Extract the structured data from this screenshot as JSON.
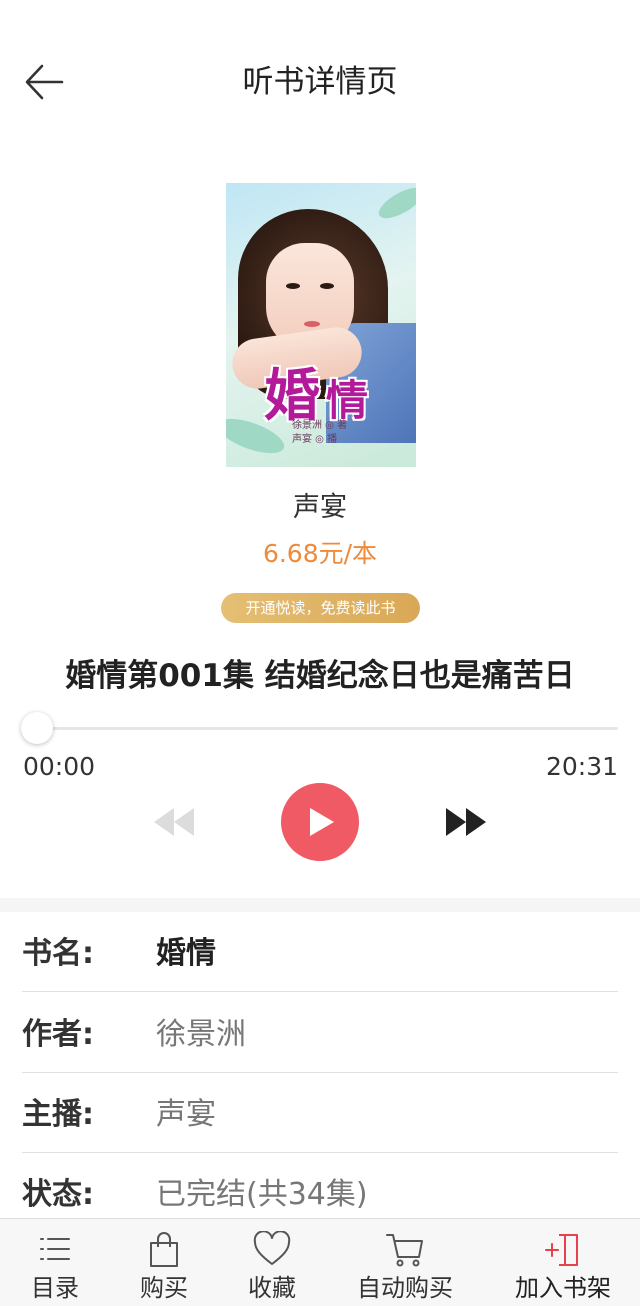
{
  "header": {
    "title": "听书详情页",
    "back_icon": "arrow-left-icon"
  },
  "book": {
    "cover_title": "婚情",
    "cover_author_line": "徐景洲 ◎ 著",
    "cover_narrator_line": "声宴 ◎ 播",
    "narrator": "声宴",
    "price": "6.68元/本",
    "vip_button": "开通悦读，免费读此书"
  },
  "player": {
    "chapter_title": "婚情第001集 结婚纪念日也是痛苦日",
    "current_time": "00:00",
    "total_time": "20:31",
    "progress": 0,
    "accent_color": "#f05a65"
  },
  "info": [
    {
      "label": "书名:",
      "value": "婚情"
    },
    {
      "label": "作者:",
      "value": "徐景洲"
    },
    {
      "label": "主播:",
      "value": "声宴"
    },
    {
      "label": "状态:",
      "value": "已完结(共34集)"
    }
  ],
  "tabbar": [
    {
      "label": "目录",
      "icon": "list-icon"
    },
    {
      "label": "购买",
      "icon": "shopping-bag-icon"
    },
    {
      "label": "收藏",
      "icon": "heart-icon"
    },
    {
      "label": "自动购买",
      "icon": "cart-icon"
    },
    {
      "label": "加入书架",
      "icon": "add-to-shelf-icon",
      "color": "#e8404c"
    }
  ]
}
